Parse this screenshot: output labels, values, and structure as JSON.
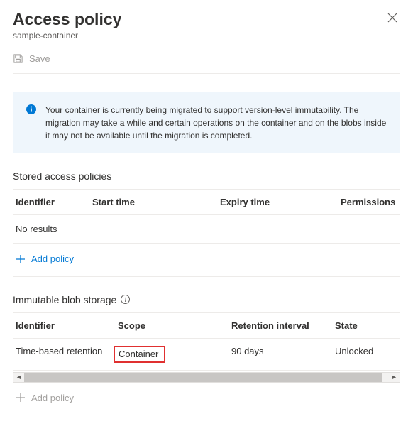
{
  "header": {
    "title": "Access policy",
    "subtitle": "sample-container"
  },
  "toolbar": {
    "save_label": "Save"
  },
  "info": {
    "message": "Your container is currently being migrated to support version-level immutability. The migration may take a while and certain operations on the container and on the blobs inside it may not be available until the migration is completed."
  },
  "stored_policies": {
    "title": "Stored access policies",
    "columns": {
      "identifier": "Identifier",
      "start": "Start time",
      "expiry": "Expiry time",
      "permissions": "Permissions"
    },
    "empty_text": "No results",
    "add_label": "Add policy"
  },
  "immutable": {
    "title": "Immutable blob storage",
    "columns": {
      "identifier": "Identifier",
      "scope": "Scope",
      "retention": "Retention interval",
      "state": "State"
    },
    "row": {
      "identifier": "Time-based retention",
      "scope": "Container",
      "retention": "90 days",
      "state": "Unlocked"
    },
    "add_label": "Add policy"
  }
}
